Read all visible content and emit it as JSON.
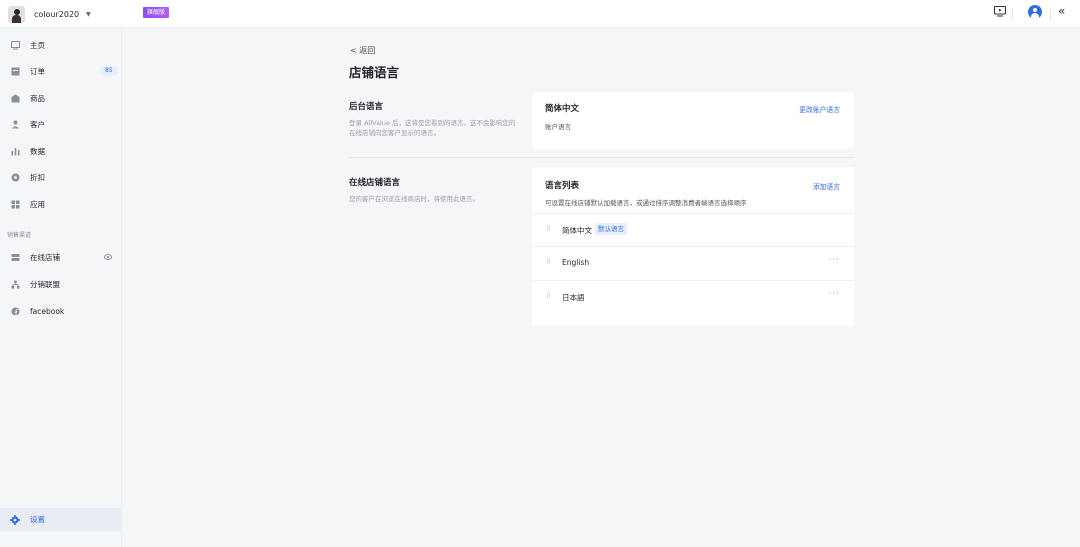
{
  "topbar": {
    "store_name": "colour2020",
    "plan_badge": "旗舰版"
  },
  "sidebar": {
    "items": [
      {
        "label": "主页",
        "icon": "home-icon"
      },
      {
        "label": "订单",
        "icon": "order-icon",
        "badge": "85"
      },
      {
        "label": "商品",
        "icon": "product-icon"
      },
      {
        "label": "客户",
        "icon": "customer-icon"
      },
      {
        "label": "数据",
        "icon": "chart-icon"
      },
      {
        "label": "折扣",
        "icon": "discount-icon"
      },
      {
        "label": "应用",
        "icon": "apps-icon"
      }
    ],
    "section_label": "销售渠道",
    "channels": [
      {
        "label": "在线店铺",
        "icon": "store-icon"
      },
      {
        "label": "分销联盟",
        "icon": "affiliate-icon"
      },
      {
        "label": "facebook",
        "icon": "facebook-icon"
      }
    ],
    "settings_label": "设置"
  },
  "main": {
    "back_label": "< 返回",
    "title": "店铺语言",
    "admin_section": {
      "title": "后台语言",
      "description": "登录 AllValue 后，这将是您看到的语言。这不会影响您的在线店铺向您客户显示的语言。"
    },
    "account_card": {
      "title": "简体中文",
      "subtitle": "账户语言",
      "link": "更改账户语言"
    },
    "store_section": {
      "title": "在线店铺语言",
      "description": "您的客户在浏览在线商店时，将使用此语言。"
    },
    "language_card": {
      "title": "语言列表",
      "subtitle": "可设置在线店铺默认加载语言，或通过排序调整消费者端语言选择顺序",
      "link": "添加语言",
      "languages": [
        {
          "name": "简体中文",
          "tag": "默认语言"
        },
        {
          "name": "English"
        },
        {
          "name": "日本語"
        }
      ]
    }
  },
  "colors": {
    "accent": "#2f6ce5",
    "badge_gradient_start": "#8e4cf2"
  }
}
